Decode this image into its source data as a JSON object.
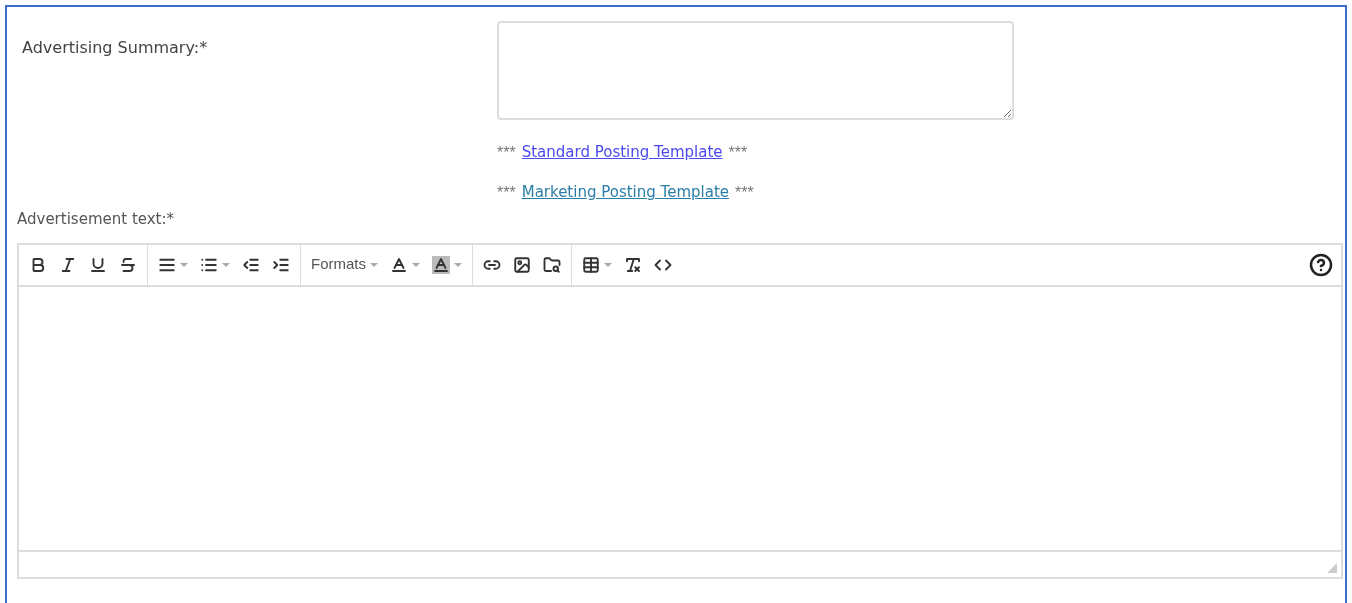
{
  "summary": {
    "label": "Advertising Summary:*"
  },
  "template_links": [
    {
      "prefix": "***",
      "link": "Standard Posting Template",
      "suffix": "***",
      "visited": false
    },
    {
      "prefix": "***",
      "link": "Marketing Posting Template",
      "suffix": "***",
      "visited": true
    }
  ],
  "editor": {
    "label": "Advertisement text:*",
    "toolbar": [
      [
        {
          "kind": "bold",
          "dropdown": false
        },
        {
          "kind": "italic",
          "dropdown": false
        },
        {
          "kind": "underline",
          "dropdown": false
        },
        {
          "kind": "strikethrough",
          "dropdown": false
        }
      ],
      [
        {
          "kind": "align",
          "dropdown": true
        },
        {
          "kind": "bullet-list",
          "dropdown": true
        },
        {
          "kind": "outdent",
          "dropdown": false
        },
        {
          "kind": "indent",
          "dropdown": false
        }
      ],
      [
        {
          "kind": "formats",
          "label": "Formats",
          "dropdown": true
        },
        {
          "kind": "text-color",
          "dropdown": true
        },
        {
          "kind": "background-color",
          "dropdown": true
        }
      ],
      [
        {
          "kind": "link",
          "dropdown": false
        },
        {
          "kind": "image",
          "dropdown": false
        },
        {
          "kind": "file-browser",
          "dropdown": false
        }
      ],
      [
        {
          "kind": "table",
          "dropdown": true
        },
        {
          "kind": "clear-format",
          "dropdown": false
        },
        {
          "kind": "source-code",
          "dropdown": false
        }
      ]
    ]
  }
}
